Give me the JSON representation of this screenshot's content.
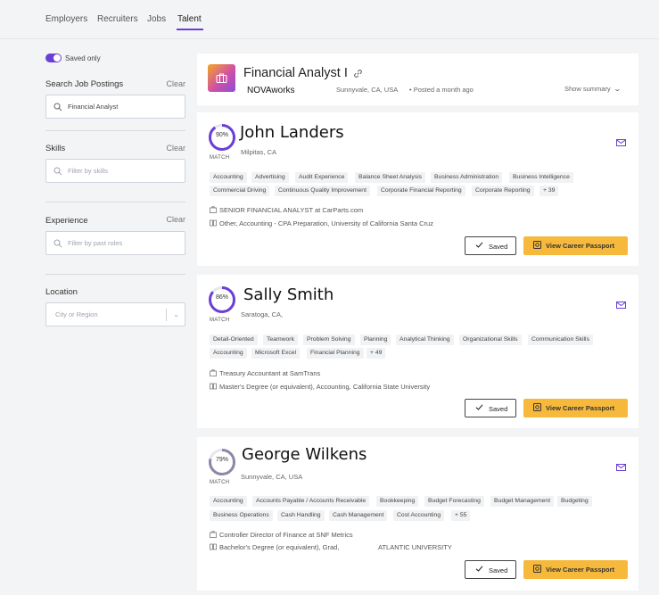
{
  "nav": {
    "tabs": [
      {
        "label": "Employers"
      },
      {
        "label": "Recruiters"
      },
      {
        "label": "Jobs"
      },
      {
        "label": "Talent"
      }
    ],
    "active_index": 3
  },
  "sidebar": {
    "saved_only_label": "Saved only",
    "saved_only_on": true,
    "search": {
      "title": "Search Job Postings",
      "clear": "Clear",
      "value": "Financial Analyst"
    },
    "skills": {
      "title": "Skills",
      "clear": "Clear",
      "placeholder": "Filter by skills"
    },
    "experience": {
      "title": "Experience",
      "clear": "Clear",
      "placeholder": "Filter by past roles"
    },
    "location": {
      "title": "Location",
      "placeholder": "City or Region"
    }
  },
  "job": {
    "title": "Financial Analyst I",
    "company": "NOVAworks",
    "location": "Sunnyvale, CA, USA",
    "posted": "• Posted a month ago",
    "show_summary": "Show summary"
  },
  "colors": {
    "accent": "#6b3fd6",
    "passport": "#f6b93b"
  },
  "candidates": [
    {
      "match_pct": "90%",
      "match_value": 90,
      "match_label": "MATCH",
      "name": "John Landers",
      "location": "Milpitas, CA",
      "skills": [
        "Accounting",
        "Advertising",
        "Audit Experience",
        "Balance Sheet Analysis",
        "Business Administration",
        "Business Intelligence",
        "Commercial Driving",
        "Continuous Quality Improvement",
        "Corporate Financial Reporting",
        "Corporate Reporting",
        "+ 39"
      ],
      "experience": "SENIOR FINANCIAL ANALYST at CarParts.com",
      "education": "Other, Accounting - CPA Preparation, University of California Santa Cruz",
      "saved_label": "Saved",
      "passport_label": "View Career Passport"
    },
    {
      "match_pct": "86%",
      "match_value": 86,
      "match_label": "MATCH",
      "name": "Sally Smith",
      "location": "Saratoga, CA,",
      "skills": [
        "Detail-Oriented",
        "Teamwork",
        "Problem Solving",
        "Planning",
        "Analytical Thinking",
        "Organizational Skills",
        "Communication Skills",
        "Accounting",
        "Microsoft Excel",
        "Financial Planning",
        "+ 49"
      ],
      "experience": "Treasury Accountant at SamTrans",
      "education": "Master's Degree (or equivalent), Accounting, California State University",
      "saved_label": "Saved",
      "passport_label": "View Career Passport"
    },
    {
      "match_pct": "79%",
      "match_value": 79,
      "match_label": "MATCH",
      "name": "George Wilkens",
      "location": "Sunnyvale, CA, USA",
      "skills": [
        "Accounting",
        "Accounts Payable / Accounts Receivable",
        "Bookkeeping",
        "Budget Forecasting",
        "Budget Management",
        "Budgeting",
        "Business Operations",
        "Cash Handling",
        "Cash Management",
        "Cost Accounting",
        "+ 55"
      ],
      "experience": "Controller Director of Finance at SNF Metrics",
      "education": "Bachelor's Degree (or equivalent), Grad,",
      "education_school": "ATLANTIC UNIVERSITY",
      "saved_label": "Saved",
      "passport_label": "View Career Passport"
    }
  ]
}
